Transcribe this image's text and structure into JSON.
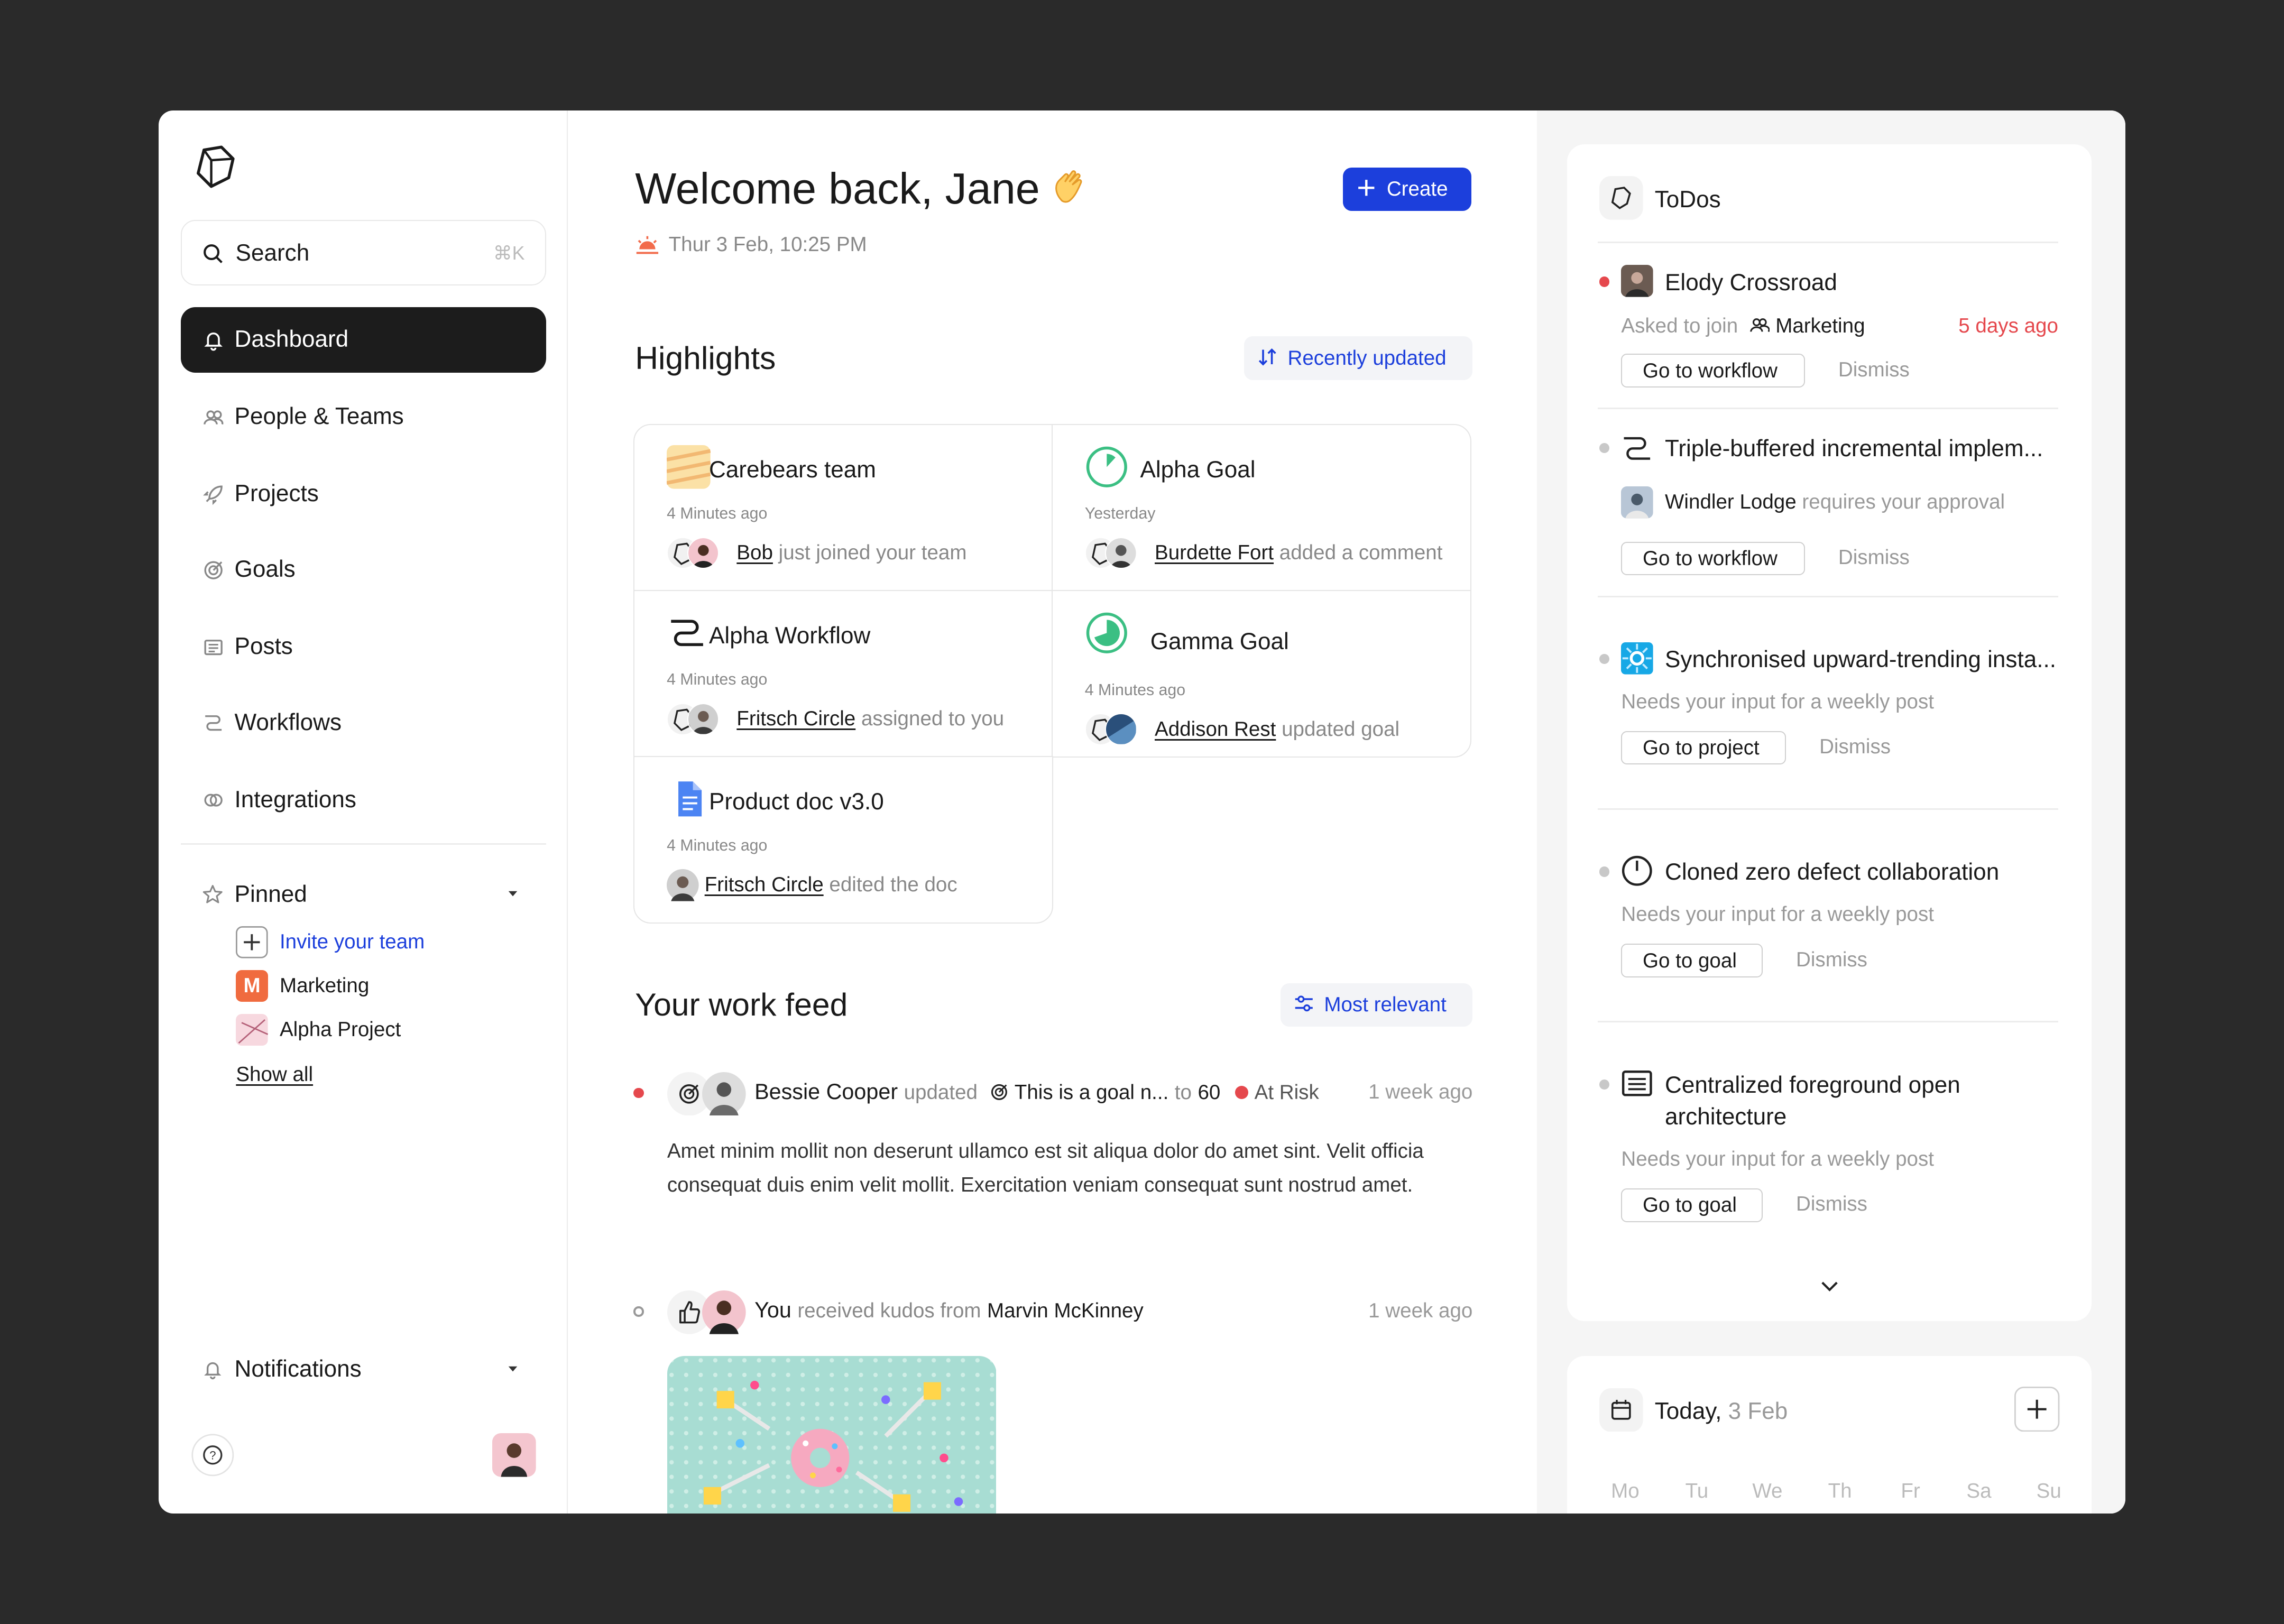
{
  "sidebar": {
    "search_label": "Search",
    "search_shortcut": "⌘K",
    "nav": [
      {
        "label": "Dashboard",
        "icon": "bell-icon"
      },
      {
        "label": "People & Teams",
        "icon": "people-icon"
      },
      {
        "label": "Projects",
        "icon": "rocket-icon"
      },
      {
        "label": "Goals",
        "icon": "target-icon"
      },
      {
        "label": "Posts",
        "icon": "posts-icon"
      },
      {
        "label": "Workflows",
        "icon": "workflow-icon"
      },
      {
        "label": "Integrations",
        "icon": "integrations-icon"
      }
    ],
    "pinned_label": "Pinned",
    "pinned": [
      {
        "label": "Invite your team"
      },
      {
        "label": "Marketing",
        "letter": "M"
      },
      {
        "label": "Alpha Project"
      }
    ],
    "show_all": "Show all",
    "notifications_label": "Notifications"
  },
  "header": {
    "greeting": "Welcome back, Jane",
    "date": "Thur 3 Feb, 10:25 PM",
    "create_label": "Create"
  },
  "highlights": {
    "title": "Highlights",
    "sort_label": "Recently updated",
    "cards": [
      {
        "title": "Carebears team",
        "time": "4 Minutes ago",
        "actor": "Bob",
        "action": "just joined your team"
      },
      {
        "title": "Alpha Goal",
        "time": "Yesterday",
        "actor": "Burdette Fort",
        "action": "added a comment"
      },
      {
        "title": "Alpha Workflow",
        "time": "4 Minutes ago",
        "actor": "Fritsch Circle",
        "action": "assigned to you"
      },
      {
        "title": "Gamma Goal",
        "time": "4 Minutes ago",
        "actor": "Addison Rest",
        "action": "updated goal"
      },
      {
        "title": "Product doc v3.0",
        "time": "4 Minutes ago",
        "actor": "Fritsch Circle",
        "action": "edited the doc"
      }
    ]
  },
  "feed": {
    "title": "Your work feed",
    "filter_label": "Most relevant",
    "items": [
      {
        "actor": "Bessie Cooper",
        "verb": "updated",
        "goal": "This is a goal n...",
        "to": "to",
        "value": "60",
        "status": "At Risk",
        "time": "1 week ago",
        "body": "Amet minim mollit non deserunt ullamco est sit aliqua dolor do amet sint. Velit officia consequat duis enim velit mollit. Exercitation veniam consequat sunt nostrud amet."
      },
      {
        "actor": "You",
        "verb": "received kudos from",
        "from": "Marvin McKinney",
        "time": "1 week ago"
      }
    ]
  },
  "todos": {
    "title": "ToDos",
    "items": [
      {
        "title": "Elody Crossroad",
        "sub_prefix": "Asked to join",
        "team": "Marketing",
        "age": "5 days ago",
        "button": "Go to workflow",
        "dismiss": "Dismiss"
      },
      {
        "title": "Triple-buffered incremental implem...",
        "person": "Windler Lodge",
        "sub": "requires your approval",
        "button": "Go to workflow",
        "dismiss": "Dismiss"
      },
      {
        "title": "Synchronised upward-trending insta...",
        "sub": "Needs your input for a weekly post",
        "button": "Go to project",
        "dismiss": "Dismiss"
      },
      {
        "title": "Cloned zero defect collaboration",
        "sub": "Needs your input for a weekly post",
        "button": "Go to goal",
        "dismiss": "Dismiss"
      },
      {
        "title_line1": "Centralized foreground open",
        "title_line2": "architecture",
        "sub": "Needs your input for a weekly post",
        "button": "Go to goal",
        "dismiss": "Dismiss"
      }
    ]
  },
  "calendar": {
    "today": "Today,",
    "date": "3 Feb",
    "days": [
      "Mo",
      "Tu",
      "We",
      "Th",
      "Fr",
      "Sa",
      "Su"
    ]
  },
  "colors": {
    "accent": "#1c3fdc",
    "risk": "#e5484d",
    "dark": "#1c1c1c"
  }
}
